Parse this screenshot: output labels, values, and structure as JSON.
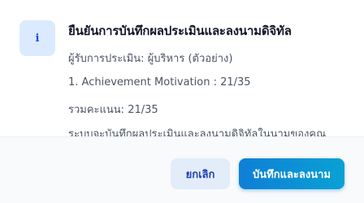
{
  "dialog": {
    "icon": "info-icon",
    "icon_glyph": "i",
    "title": "ยืนยันการบันทึกผลประเมินและลงนามดิจิทัล",
    "recipient": "ผู้รับการประเมิน: ผู้บริหาร (ตัวอย่าง)",
    "item_line": "1. Achievement Motivation : 21/35",
    "total_line": "รวมคะแนน: 21/35",
    "note": "ระบบจะบันทึกผลประเมินและลงนามดิจิทัลในนามของคุณ"
  },
  "footer": {
    "cancel_label": "ยกเลิก",
    "confirm_label": "บันทึกและลงนาม"
  },
  "colors": {
    "icon_bg": "#dbeafe",
    "icon_fg": "#1d4ed8",
    "cancel_bg": "#e3ecf9",
    "confirm_bg": "#0e7fd6"
  }
}
